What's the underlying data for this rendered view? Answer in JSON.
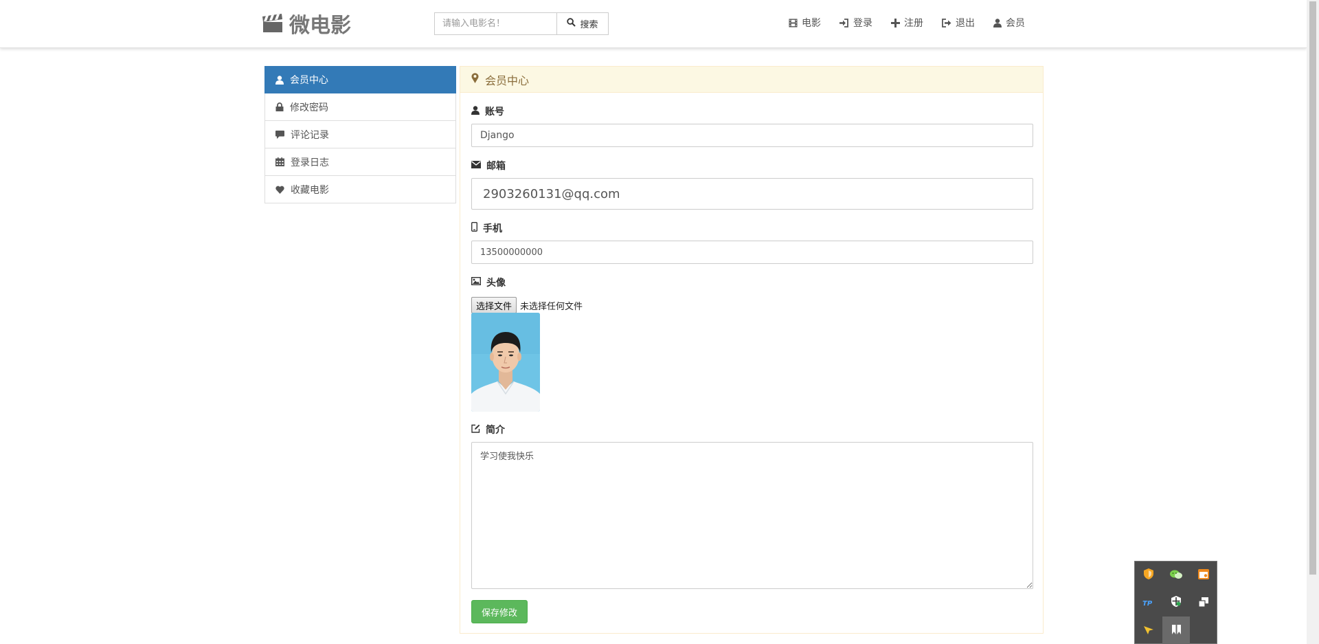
{
  "brand": {
    "name": "微电影"
  },
  "search": {
    "placeholder": "请输入电影名！",
    "button_label": "搜索"
  },
  "nav": {
    "movies": "电影",
    "login": "登录",
    "register": "注册",
    "logout": "退出",
    "member": "会员"
  },
  "sidebar": {
    "items": [
      {
        "label": "会员中心",
        "icon": "user-icon",
        "active": true
      },
      {
        "label": "修改密码",
        "icon": "lock-icon"
      },
      {
        "label": "评论记录",
        "icon": "comment-icon"
      },
      {
        "label": "登录日志",
        "icon": "calendar-icon"
      },
      {
        "label": "收藏电影",
        "icon": "heart-icon"
      }
    ]
  },
  "panel": {
    "title": "会员中心",
    "account": {
      "label": "账号",
      "value": "Django"
    },
    "email": {
      "label": "邮箱",
      "value": "2903260131@qq.com"
    },
    "phone": {
      "label": "手机",
      "value": "13500000000"
    },
    "avatar": {
      "label": "头像",
      "file_button": "选择文件",
      "file_status": "未选择任何文件"
    },
    "bio": {
      "label": "简介",
      "value": "学习使我快乐"
    },
    "save_label": "保存修改"
  },
  "colors": {
    "primary": "#337ab7",
    "success": "#5cb85c",
    "warning_bg": "#fcf8e3",
    "warning_border": "#faebcc",
    "warning_text": "#8a6d3b"
  }
}
